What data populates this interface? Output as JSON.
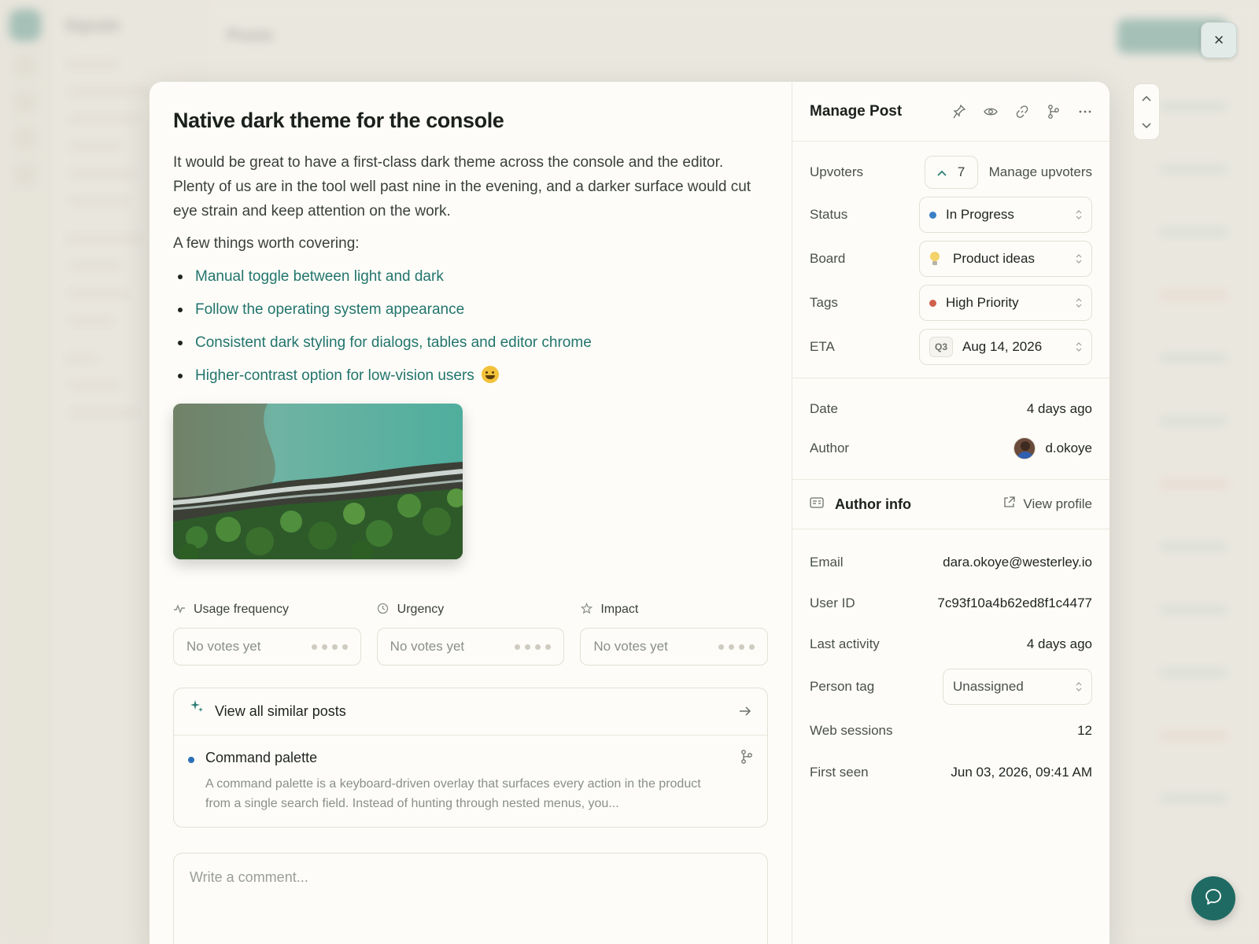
{
  "background": {
    "app_name": "Signals",
    "page_title": "Posts",
    "sidebar_placeholder_lines": 14
  },
  "close_label": "×",
  "post": {
    "title": "Native dark theme for the console",
    "paragraphs": [
      "It would be great to have a first-class dark theme across the console and the editor. Plenty of us are in the tool well past nine in the evening, and a darker surface would cut eye strain and keep attention on the work.",
      "A few things worth covering:"
    ],
    "bullets": [
      "Manual toggle between light and dark",
      "Follow the operating system appearance",
      "Consistent dark styling for dialogs, tables and editor chrome",
      "Higher-contrast option for low-vision users"
    ],
    "last_bullet_emoji": "grinning-face-emoji"
  },
  "votes": [
    {
      "label": "Usage frequency",
      "icon": "activity-icon",
      "value": "No votes yet"
    },
    {
      "label": "Urgency",
      "icon": "clock-icon",
      "value": "No votes yet"
    },
    {
      "label": "Impact",
      "icon": "star-icon",
      "value": "No votes yet"
    }
  ],
  "similar": {
    "header": "View all similar posts",
    "item_title": "Command palette",
    "item_desc": "A command palette is a keyboard-driven overlay that surfaces every action in the product from a single search field. Instead of hunting through nested menus, you..."
  },
  "comment": {
    "placeholder": "Write a comment..."
  },
  "manage": {
    "title": "Manage Post",
    "upvoters_label": "Upvoters",
    "upvote_count": "7",
    "manage_upvoters": "Manage upvoters",
    "status_label": "Status",
    "status_value": "In Progress",
    "status_color": "#3b7fc4",
    "board_label": "Board",
    "board_value": "Product ideas",
    "tags_label": "Tags",
    "tags_value": "High Priority",
    "tags_color": "#d0604a",
    "eta_label": "ETA",
    "eta_quarter": "Q3",
    "eta_value": "Aug 14, 2026",
    "date_label": "Date",
    "date_value": "4 days ago",
    "author_label": "Author",
    "author_value": "d.okoye"
  },
  "author_info": {
    "title": "Author info",
    "view_profile": "View profile",
    "email_label": "Email",
    "email_value": "dara.okoye@westerley.io",
    "userid_label": "User ID",
    "userid_value": "7c93f10a4b62ed8f1c4477",
    "last_activity_label": "Last activity",
    "last_activity_value": "4 days ago",
    "person_tag_label": "Person tag",
    "person_tag_value": "Unassigned",
    "web_sessions_label": "Web sessions",
    "web_sessions_value": "12",
    "first_seen_label": "First seen",
    "first_seen_value": "Jun 03, 2026, 09:41 AM"
  },
  "colors": {
    "accent": "#2f7f77",
    "link": "#22756d"
  }
}
